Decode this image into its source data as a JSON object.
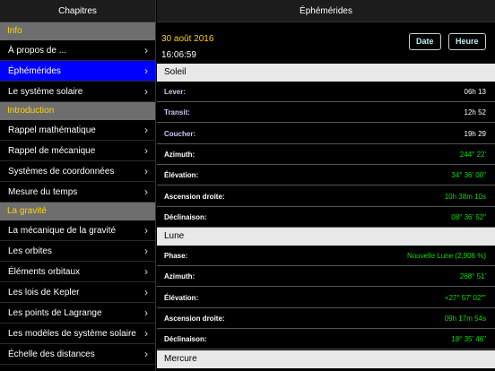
{
  "sidebar": {
    "title": "Chapitres",
    "sections": [
      {
        "title": "Info",
        "items": [
          {
            "label": "À propos de ...",
            "selected": false
          },
          {
            "label": "Éphémérides",
            "selected": true
          },
          {
            "label": "Le système solaire",
            "selected": false
          }
        ]
      },
      {
        "title": "Introduction",
        "items": [
          {
            "label": "Rappel mathématique",
            "selected": false
          },
          {
            "label": "Rappel de mécanique",
            "selected": false
          },
          {
            "label": "Systèmes de coordonnées",
            "selected": false
          },
          {
            "label": "Mesure du temps",
            "selected": false
          }
        ]
      },
      {
        "title": "La gravité",
        "items": [
          {
            "label": "La mécanique de la gravité",
            "selected": false
          },
          {
            "label": "Les orbites",
            "selected": false
          },
          {
            "label": "Éléments orbitaux",
            "selected": false
          },
          {
            "label": "Les lois de Kepler",
            "selected": false
          },
          {
            "label": "Les points de Lagrange",
            "selected": false
          },
          {
            "label": "Les modèles de système solaire",
            "selected": false
          },
          {
            "label": "Échelle des distances",
            "selected": false
          }
        ]
      }
    ],
    "chevron": "›"
  },
  "main": {
    "title": "Éphémérides",
    "date": "30 août 2016",
    "time": "16:06:59",
    "date_button": "Date",
    "time_button": "Heure",
    "groups": [
      {
        "title": "Soleil",
        "rows": [
          {
            "label": "Lever:",
            "value": "06h 13",
            "green": false
          },
          {
            "label": "Transit:",
            "value": "12h 52",
            "green": false
          },
          {
            "label": "Coucher:",
            "value": "19h 29",
            "green": false
          },
          {
            "label": "Azimuth:",
            "value": "244° 22'",
            "green": true
          },
          {
            "label": "Élévation:",
            "value": "34° 36' 00\"",
            "green": true
          },
          {
            "label": "Ascension droite:",
            "value": "10h 38m 10s",
            "green": true
          },
          {
            "label": "Déclinaison:",
            "value": "08° 36' 52\"",
            "green": true
          }
        ]
      },
      {
        "title": "Lune",
        "rows": [
          {
            "label": "Phase:",
            "value": "Nouvelle Lune (2,906 %)",
            "green": true
          },
          {
            "label": "Azimuth:",
            "value": "268° 51'",
            "green": true
          },
          {
            "label": "Élévation:",
            "value": "+27° 57' 02\"\"",
            "green": true
          },
          {
            "label": "Ascension droite:",
            "value": "09h 17m 54s",
            "green": true
          },
          {
            "label": "Déclinaison:",
            "value": "18° 35' 46\"",
            "green": true
          }
        ]
      },
      {
        "title": "Mercure",
        "rows": []
      }
    ]
  },
  "colors": {
    "accent": "#ffd400",
    "selected": "#0000ff",
    "value_green": "#00e000",
    "section_bg": "#6e6e6e"
  }
}
